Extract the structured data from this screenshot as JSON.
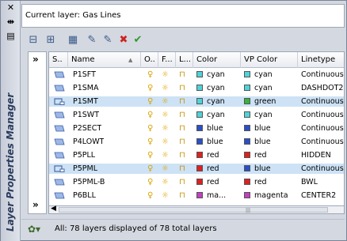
{
  "panel": {
    "vertical_title": "Layer Properties Manager",
    "current_layer": "Current layer: Gas Lines",
    "close_glyph": "✕",
    "autohide_glyph": "⇹",
    "props_glyph": "▤"
  },
  "toolbar": {
    "buttons": [
      {
        "name": "new-property-filter-icon",
        "glyph": "⊟"
      },
      {
        "name": "new-group-filter-icon",
        "glyph": "⊞"
      },
      {
        "name": "layer-states-manager-icon",
        "glyph": "▦"
      },
      {
        "name": "new-layer-icon",
        "glyph": "✎"
      },
      {
        "name": "new-layer-vp-frozen-icon",
        "glyph": "✎"
      },
      {
        "name": "delete-layer-icon",
        "glyph": "✖",
        "color": "#d02020"
      },
      {
        "name": "set-current-icon",
        "glyph": "✔",
        "color": "#2a9a2a"
      }
    ]
  },
  "tree": {
    "expand_glyph": "»",
    "collapse_glyph": "»"
  },
  "columns": [
    "S..",
    "Name",
    "O..",
    "F...",
    "L...",
    "Color",
    "VP Color",
    "Linetype"
  ],
  "sort_glyph": "▲",
  "rows": [
    {
      "name": "P1SFT",
      "color": "cyan",
      "color_hex": "#4fd3d8",
      "vp": "cyan",
      "vp_hex": "#4fd3d8",
      "linetype": "Continuous",
      "sel": false,
      "icon": "layer"
    },
    {
      "name": "P1SMA",
      "color": "cyan",
      "color_hex": "#4fd3d8",
      "vp": "cyan",
      "vp_hex": "#4fd3d8",
      "linetype": "DASHDOT2",
      "sel": false,
      "icon": "layer"
    },
    {
      "name": "P1SMT",
      "color": "cyan",
      "color_hex": "#4fd3d8",
      "vp": "green",
      "vp_hex": "#36b43a",
      "linetype": "Continuous",
      "sel": true,
      "icon": "vp"
    },
    {
      "name": "P1SWT",
      "color": "cyan",
      "color_hex": "#4fd3d8",
      "vp": "cyan",
      "vp_hex": "#4fd3d8",
      "linetype": "Continuous",
      "sel": false,
      "icon": "layer"
    },
    {
      "name": "P2SECT",
      "color": "blue",
      "color_hex": "#2a4fc8",
      "vp": "blue",
      "vp_hex": "#2a4fc8",
      "linetype": "Continuous",
      "sel": false,
      "icon": "layer"
    },
    {
      "name": "P4LOWT",
      "color": "blue",
      "color_hex": "#2a4fc8",
      "vp": "blue",
      "vp_hex": "#2a4fc8",
      "linetype": "Continuous",
      "sel": false,
      "icon": "layer"
    },
    {
      "name": "P5PLL",
      "color": "red",
      "color_hex": "#e02020",
      "vp": "red",
      "vp_hex": "#e02020",
      "linetype": "HIDDEN",
      "sel": false,
      "icon": "layer"
    },
    {
      "name": "P5PML",
      "color": "red",
      "color_hex": "#e02020",
      "vp": "blue",
      "vp_hex": "#2a4fc8",
      "linetype": "Continuous",
      "sel": true,
      "icon": "vp"
    },
    {
      "name": "P5PML-B",
      "color": "red",
      "color_hex": "#e02020",
      "vp": "red",
      "vp_hex": "#e02020",
      "linetype": "BWL",
      "sel": false,
      "icon": "layer"
    },
    {
      "name": "P6BLL",
      "color": "ma...",
      "color_hex": "#c040c0",
      "vp": "magenta",
      "vp_hex": "#c040c0",
      "linetype": "CENTER2",
      "sel": false,
      "icon": "layer"
    }
  ],
  "status": {
    "text": "All: 78 layers displayed of 78 total layers"
  }
}
